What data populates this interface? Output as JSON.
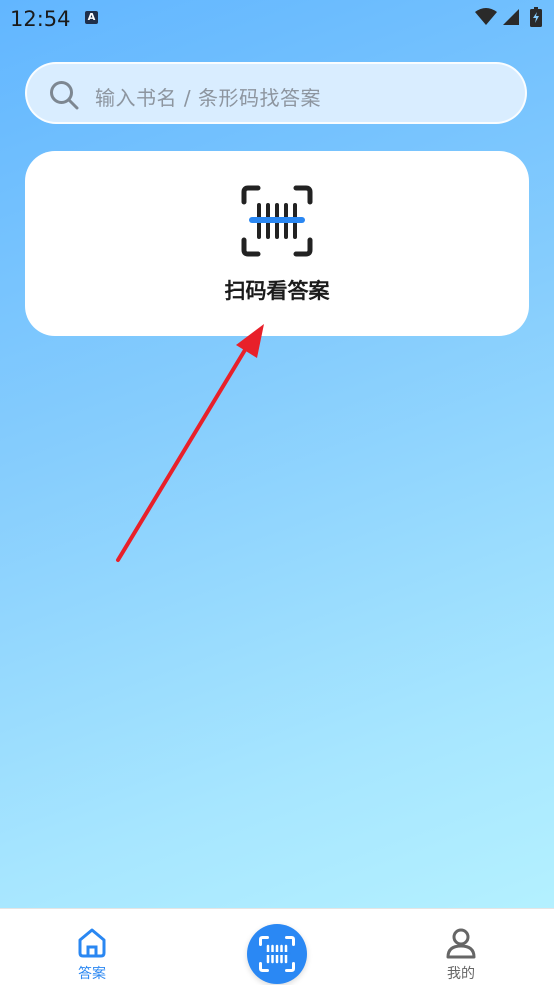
{
  "status_bar": {
    "time": "12:54",
    "notification_badge": "A"
  },
  "search": {
    "placeholder": "输入书名 / 条形码找答案"
  },
  "scan_card": {
    "label": "扫码看答案",
    "icon": "barcode-scan-icon"
  },
  "bottom_nav": {
    "items": [
      {
        "label": "答案",
        "icon": "home-icon",
        "active": true
      },
      {
        "label": "",
        "icon": "barcode-scan-icon",
        "active": false
      },
      {
        "label": "我的",
        "icon": "user-icon",
        "active": false
      }
    ]
  },
  "colors": {
    "accent": "#2a87f2",
    "annotation_arrow": "#e8202a"
  }
}
